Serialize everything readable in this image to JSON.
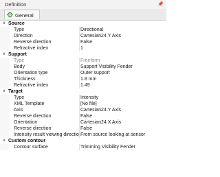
{
  "window": {
    "title": "Definition",
    "pin_glyph": "p"
  },
  "tab": {
    "label": "General",
    "icon": "gear-icon"
  },
  "sections": [
    {
      "name": "Source",
      "props": [
        {
          "name": "Type",
          "value": "Directional"
        },
        {
          "name": "Direction",
          "value": "Cartesian24.Y Axis"
        },
        {
          "name": "Reverse direction",
          "value": "False"
        },
        {
          "name": "Refractive index",
          "value": "1"
        }
      ]
    },
    {
      "name": "Support",
      "props": [
        {
          "name": "Type",
          "value": "Freeform",
          "disabled": true
        },
        {
          "name": "Body",
          "value": "Support Visibility Fender"
        },
        {
          "name": "Orientation type",
          "value": "Outer support"
        },
        {
          "name": "Thickness",
          "value": "1.8 mm"
        },
        {
          "name": "Refractive index",
          "value": "1.49"
        }
      ]
    },
    {
      "name": "Target",
      "props": [
        {
          "name": "Type",
          "value": "Intensity"
        },
        {
          "name": "XML Template",
          "value": "[No file]"
        },
        {
          "name": "Axis",
          "value": "Cartesian24.Y Axis"
        },
        {
          "name": "Reverse direction",
          "value": "False"
        },
        {
          "name": "Orientation",
          "value": "Cartesian24.X Axis"
        },
        {
          "name": "Reverse direction",
          "value": "False"
        },
        {
          "name": "Intensity result viewing direction",
          "value": "From source looking at sensor"
        }
      ]
    },
    {
      "name": "Custom contour",
      "props": [
        {
          "name": "Contour surface",
          "value": "Trimming Visibility Fender"
        }
      ]
    }
  ],
  "colors": {
    "accent_icon": "#3a8a3a"
  }
}
